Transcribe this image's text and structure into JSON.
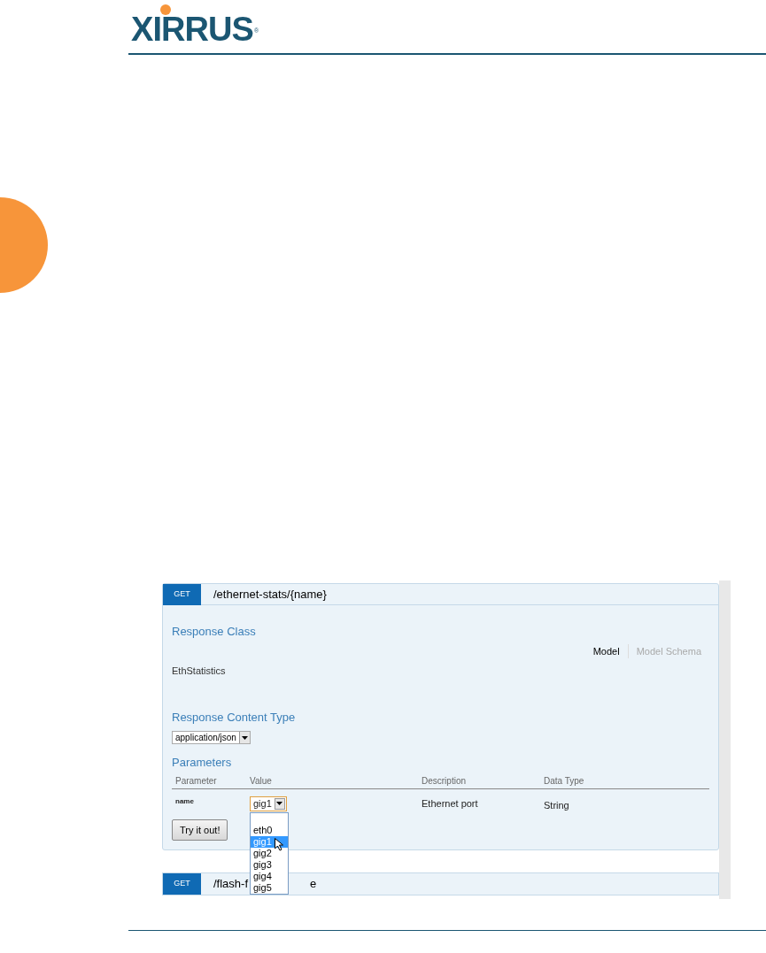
{
  "logo": {
    "text": "XIRRUS",
    "mark": "®"
  },
  "endpoint": {
    "method": "GET",
    "path": "/ethernet-stats/{name}",
    "response_class": {
      "title": "Response Class",
      "model_tabs": [
        {
          "label": "Model",
          "selected": true
        },
        {
          "label": "Model Schema",
          "selected": false
        }
      ],
      "model": "EthStatistics"
    },
    "content_type": {
      "title": "Response Content Type",
      "value": "application/json"
    },
    "parameters": {
      "title": "Parameters",
      "columns": [
        "Parameter",
        "Value",
        "Description",
        "Data Type"
      ],
      "rows": [
        {
          "parameter": "name",
          "value": "gig1",
          "description": "Ethernet port",
          "data_type": "String",
          "options": [
            {
              "label": "eth0",
              "selected": false
            },
            {
              "label": "gig1",
              "selected": true
            },
            {
              "label": "gig2",
              "selected": false
            },
            {
              "label": "gig3",
              "selected": false
            },
            {
              "label": "gig4",
              "selected": false
            },
            {
              "label": "gig5",
              "selected": false
            }
          ]
        }
      ]
    },
    "button": "Try it out!"
  },
  "next_endpoint": {
    "method": "GET",
    "path_start": "/flash-f",
    "path_end": "e"
  }
}
